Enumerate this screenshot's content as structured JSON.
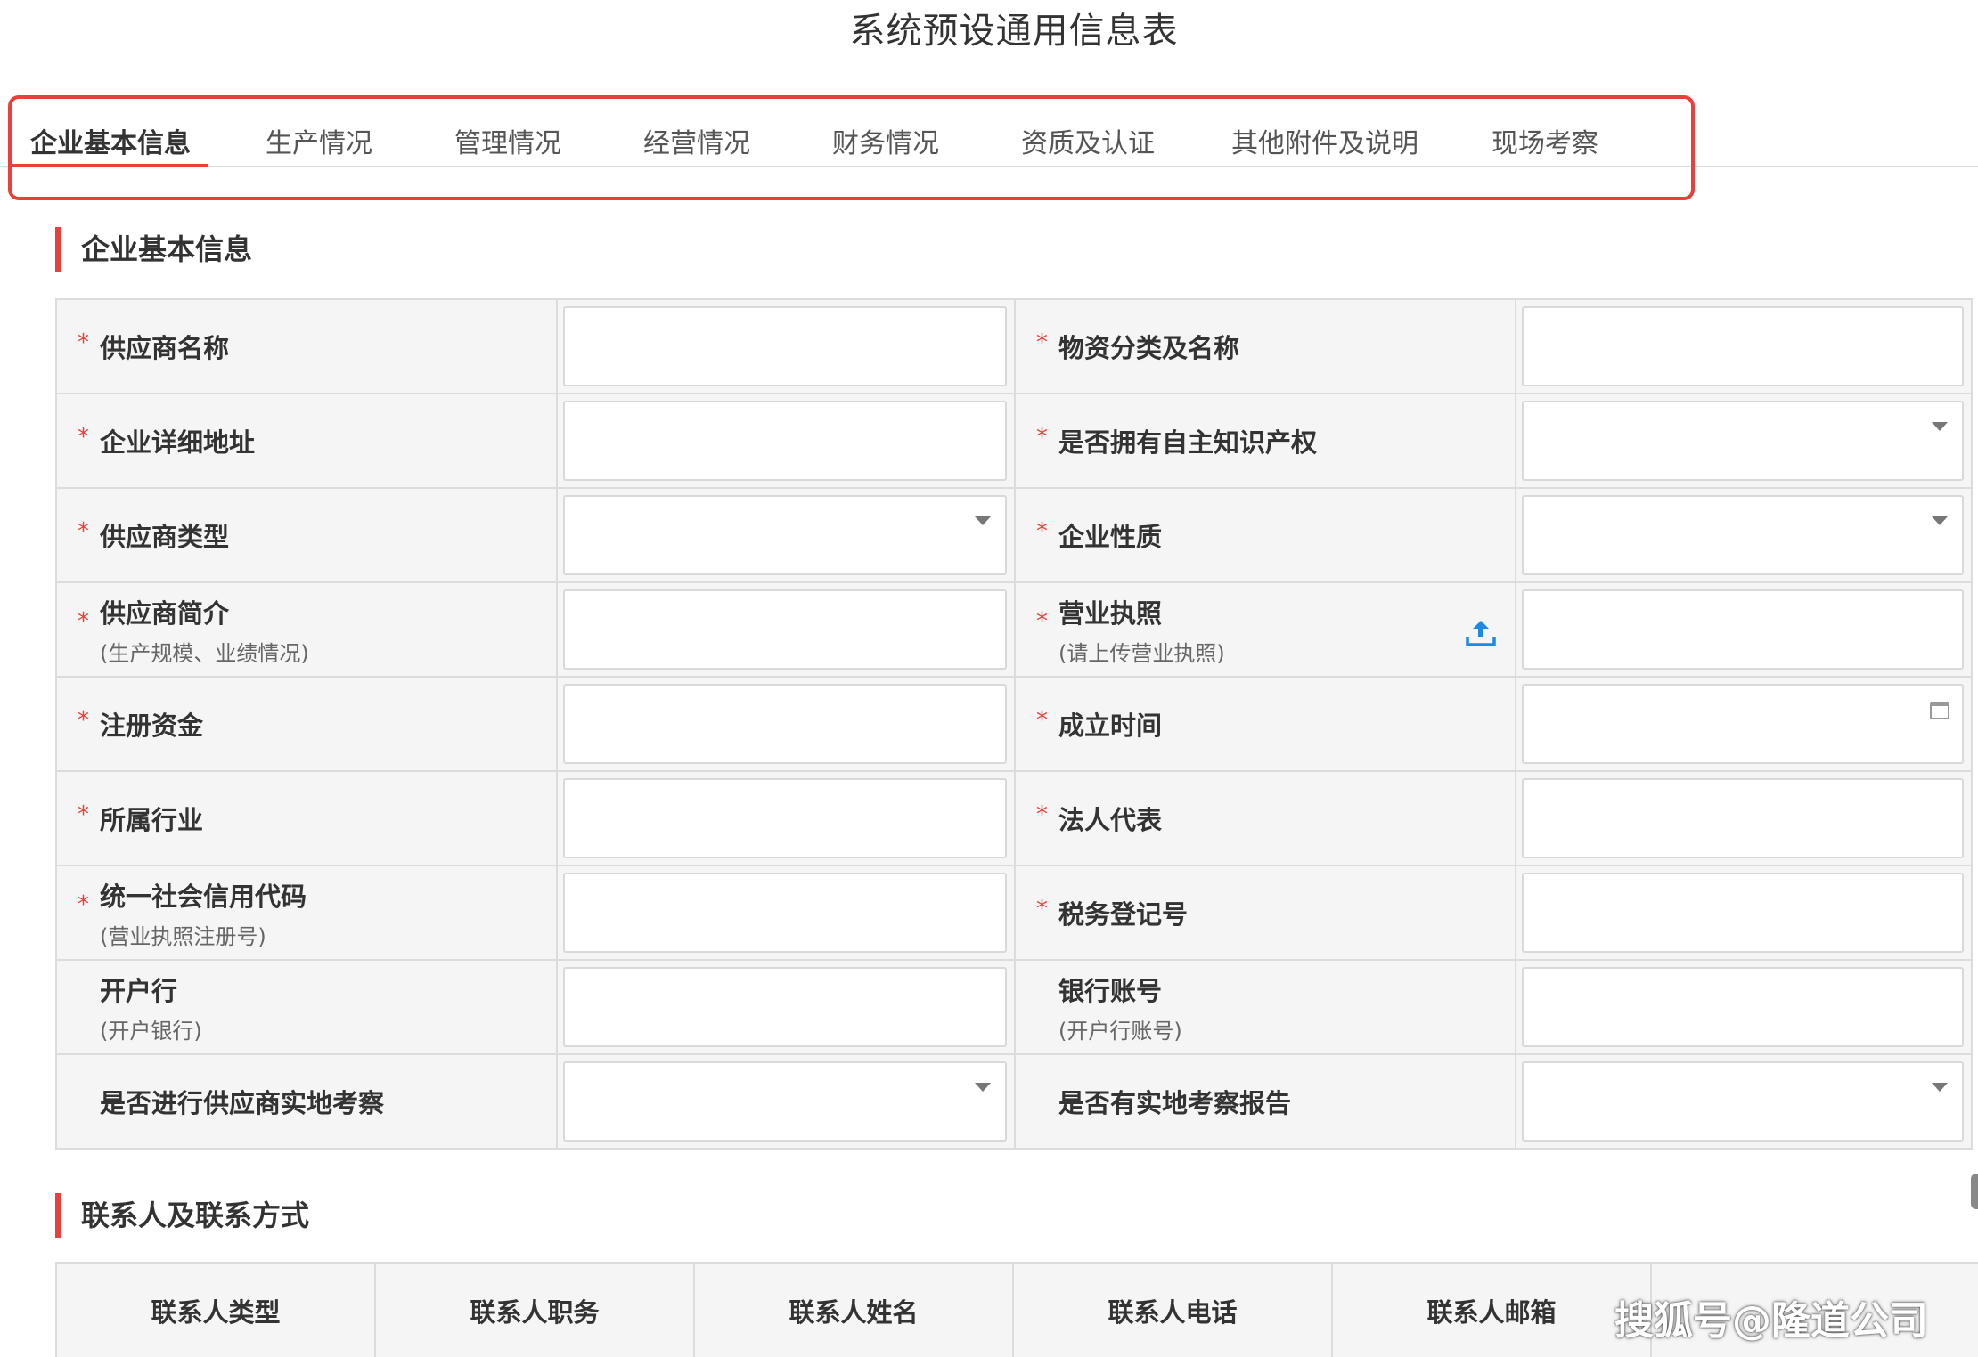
{
  "page_title": "系统预设通用信息表",
  "tabs": [
    {
      "label": "企业基本信息",
      "active": true
    },
    {
      "label": "生产情况"
    },
    {
      "label": "管理情况"
    },
    {
      "label": "经营情况"
    },
    {
      "label": "财务情况"
    },
    {
      "label": "资质及认证"
    },
    {
      "label": "其他附件及说明"
    },
    {
      "label": "现场考察"
    }
  ],
  "sections": {
    "basic_title": "企业基本信息",
    "contact_title": "联系人及联系方式"
  },
  "form": {
    "r1": {
      "left_label": "供应商名称",
      "right_label": "物资分类及名称"
    },
    "r2": {
      "left_label": "企业详细地址",
      "right_label": "是否拥有自主知识产权"
    },
    "r3": {
      "left_label": "供应商类型",
      "right_label": "企业性质"
    },
    "r4": {
      "left_label": "供应商简介",
      "left_sub": "(生产规模、业绩情况)",
      "right_label": "营业执照",
      "right_sub": "(请上传营业执照)"
    },
    "r5": {
      "left_label": "注册资金",
      "right_label": "成立时间"
    },
    "r6": {
      "left_label": "所属行业",
      "right_label": "法人代表"
    },
    "r7": {
      "left_label": "统一社会信用代码",
      "left_sub": "(营业执照注册号)",
      "right_label": "税务登记号"
    },
    "r8": {
      "left_label": "开户行",
      "left_sub": "(开户银行)",
      "right_label": "银行账号",
      "right_sub": "(开户行账号)"
    },
    "r9": {
      "left_label": "是否进行供应商实地考察",
      "right_label": "是否有实地考察报告"
    },
    "required_mark": "*"
  },
  "contact_table": {
    "headers": [
      "联系人类型",
      "联系人职务",
      "联系人姓名",
      "联系人电话",
      "联系人邮箱"
    ]
  },
  "watermark": "搜狐号@隆道公司",
  "colors": {
    "accent": "#e8413a",
    "label_bg": "#f5f5f5",
    "upload_icon": "#1e88e5"
  }
}
